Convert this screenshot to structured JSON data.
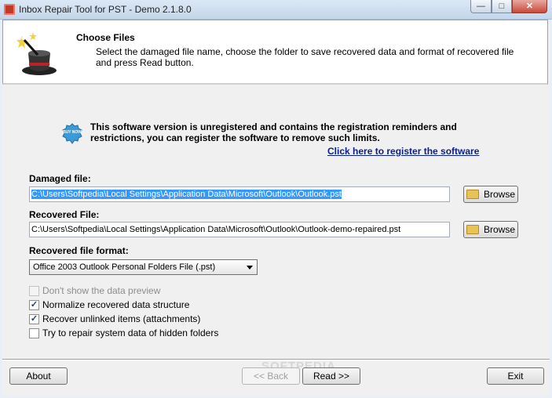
{
  "window": {
    "title": "Inbox Repair Tool for PST - Demo 2.1.8.0",
    "min_glyph": "—",
    "max_glyph": "□",
    "close_glyph": "✕"
  },
  "header": {
    "title": "Choose Files",
    "description": "Select the damaged file name, choose the folder to save recovered data and format of recovered file and press Read button.",
    "icon": "magic-hat-icon"
  },
  "registration": {
    "icon": "buy-now-icon",
    "badge_text": "BUY NOW",
    "message": "This software version is unregistered and contains the registration reminders and restrictions, you can register the software to remove such limits.",
    "link": "Click here to register the software "
  },
  "damaged_file": {
    "label": "Damaged file:",
    "value": "C:\\Users\\Softpedia\\Local Settings\\Application Data\\Microsoft\\Outlook\\Outlook.pst",
    "browse_label": "Browse"
  },
  "recovered_file": {
    "label": "Recovered File:",
    "value": "C:\\Users\\Softpedia\\Local Settings\\Application Data\\Microsoft\\Outlook\\Outlook-demo-repaired.pst",
    "browse_label": "Browse"
  },
  "format": {
    "label": "Recovered file format:",
    "selected": "Office 2003 Outlook Personal Folders File (.pst)"
  },
  "options": [
    {
      "label": "Don't show the data preview",
      "checked": false,
      "disabled": true
    },
    {
      "label": "Normalize recovered data structure",
      "checked": true,
      "disabled": false
    },
    {
      "label": "Recover unlinked items (attachments)",
      "checked": true,
      "disabled": false
    },
    {
      "label": "Try to repair system data of hidden folders",
      "checked": false,
      "disabled": false
    }
  ],
  "footer": {
    "about_label": "About",
    "back_label": "<< Back",
    "read_label": "Read >>",
    "exit_label": "Exit",
    "watermark": "SOFTPEDIA"
  },
  "colors": {
    "link": "#0a1f8a",
    "selection": "#3399ff"
  }
}
